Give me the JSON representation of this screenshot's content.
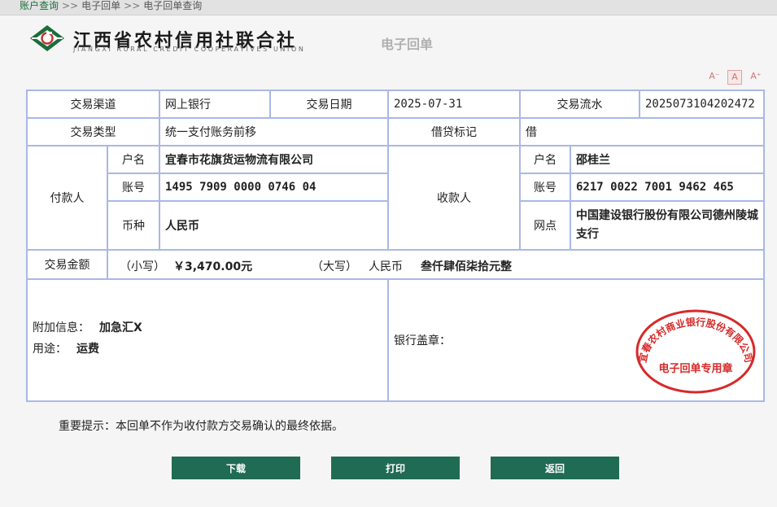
{
  "breadcrumb": {
    "items": [
      "账户查询",
      "电子回单",
      "电子回单查询"
    ],
    "separator": ">>"
  },
  "header": {
    "logo_cn": "江西省农村信用社联合社",
    "logo_en": "JIANGXI RURAL CREDIT COOPERATIVES UNION",
    "doc_title": "电子回单"
  },
  "font_controls": {
    "decrease": "A⁻",
    "normal": "A",
    "increase": "A⁺"
  },
  "receipt": {
    "channel_label": "交易渠道",
    "channel_value": "网上银行",
    "date_label": "交易日期",
    "date_value": "2025-07-31",
    "serial_label": "交易流水",
    "serial_value": "2025073104202472",
    "type_label": "交易类型",
    "type_value": "统一支付账务前移",
    "dc_label": "借贷标记",
    "dc_value": "借",
    "payer": {
      "label": "付款人",
      "name_label": "户名",
      "name_value": "宜春市花旗货运物流有限公司",
      "account_label": "账号",
      "account_value": "1495 7909 0000 0746 04",
      "currency_label": "币种",
      "currency_value": "人民币"
    },
    "payee": {
      "label": "收款人",
      "name_label": "户名",
      "name_value": "邵桂兰",
      "account_label": "账号",
      "account_value": "6217 0022 7001 9462 465",
      "branch_label": "网点",
      "branch_value": "中国建设银行股份有限公司德州陵城支行"
    },
    "amount": {
      "label": "交易金额",
      "small_label": "（小写）",
      "small_value": "￥3,470.00元",
      "big_label": "（大写）",
      "big_currency": "人民币",
      "big_value": "叁仟肆佰柒拾元整"
    },
    "extra_label": "附加信息：",
    "extra_value": "加急汇Ⅹ",
    "purpose_label": "用途：",
    "purpose_value": "运费",
    "seal_label": "银行盖章：",
    "stamp_text_arc": "宜春农村商业银行股份有限公司",
    "stamp_text_center": "电子回单专用章"
  },
  "notice": "重要提示：本回单不作为收付款方交易确认的最终依据。",
  "buttons": {
    "download": "下载",
    "print": "打印",
    "back": "返回"
  },
  "colors": {
    "border": "#a9b8e6",
    "button": "#1f6b53",
    "stamp": "#d62a2a",
    "logo_green": "#1a6d3c"
  }
}
